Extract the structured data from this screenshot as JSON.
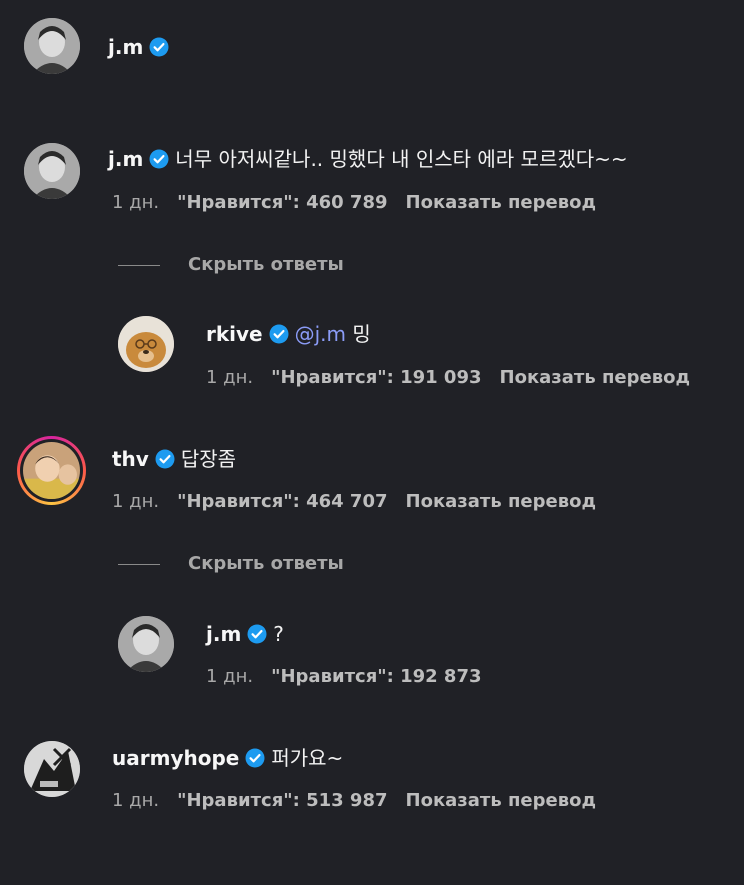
{
  "header": {
    "username": "j.m"
  },
  "comments": [
    {
      "username": "j.m",
      "text": "너무 아저씨같나.. 밍했다 내 인스타 에라 모르겠다~~",
      "time": "1 дн.",
      "likes": "\"Нравится\": 460 789",
      "translate": "Показать перевод",
      "hide_replies": "Скрыть ответы",
      "reply": {
        "username": "rkive",
        "mention": "@j.m",
        "text": "밍",
        "time": "1 дн.",
        "likes": "\"Нравится\": 191 093",
        "translate": "Показать перевод"
      }
    },
    {
      "username": "thv",
      "text": "답장좀",
      "time": "1 дн.",
      "likes": "\"Нравится\": 464 707",
      "translate": "Показать перевод",
      "hide_replies": "Скрыть ответы",
      "reply": {
        "username": "j.m",
        "text": "?",
        "time": "1 дн.",
        "likes": "\"Нравится\": 192 873"
      }
    },
    {
      "username": "uarmyhope",
      "text": "퍼가요~",
      "time": "1 дн.",
      "likes": "\"Нравится\": 513 987",
      "translate": "Показать перевод"
    }
  ],
  "colors": {
    "background": "#202126",
    "verified": "#1d9bf0",
    "mention": "#8b9cf7",
    "muted": "#a8a8a8"
  },
  "icons": {
    "verified": "verified-badge-icon"
  }
}
